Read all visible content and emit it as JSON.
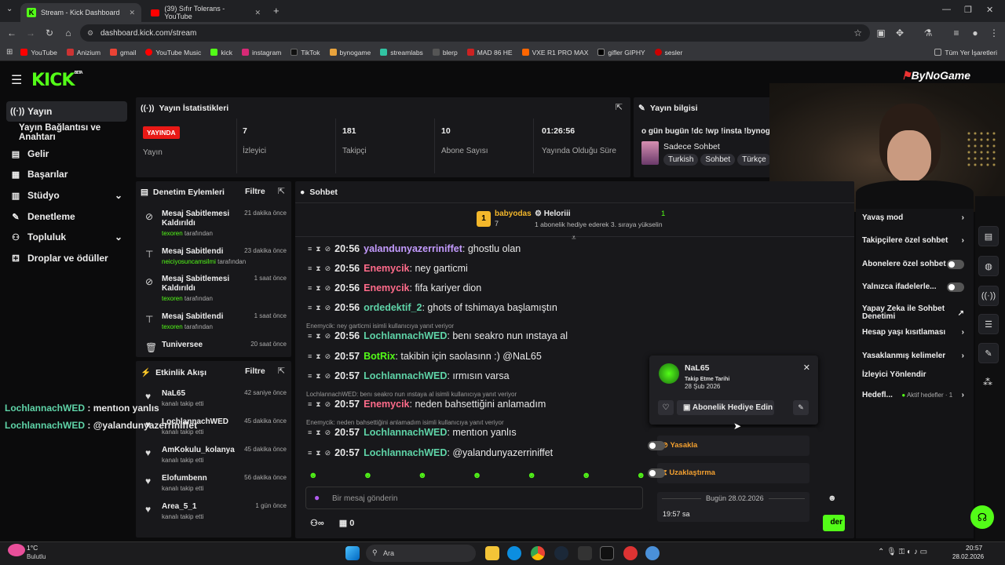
{
  "browser": {
    "tabs": [
      {
        "title": "Stream - Kick Dashboard"
      },
      {
        "title": "(39) Sıfır Tolerans - YouTube"
      }
    ],
    "url": "dashboard.kick.com/stream",
    "bookmarks": [
      "YouTube",
      "Anizium",
      "gmail",
      "YouTube Music",
      "kick",
      "instagram",
      "TikTok",
      "bynogame",
      "streamlabs",
      "blerp",
      "MAD 86 HE",
      "VXE R1 PRO MAX",
      "gifler GIPHY",
      "sesler"
    ],
    "all_bookmarks": "Tüm Yer İşaretleri"
  },
  "header": {
    "logo": "KICK",
    "beta": "BETA",
    "overlay_brand": "ByNoGame"
  },
  "sidebar": {
    "items": [
      {
        "label": "Yayın",
        "icon": "broadcast-icon"
      },
      {
        "label": "Yayın Bağlantısı ve Anahtarı"
      },
      {
        "label": "Gelir",
        "icon": "money-icon"
      },
      {
        "label": "Başarılar",
        "icon": "trophy-icon"
      },
      {
        "label": "Stüdyo",
        "icon": "studio-icon"
      },
      {
        "label": "Denetleme",
        "icon": "wrench-icon"
      },
      {
        "label": "Topluluk",
        "icon": "community-icon"
      },
      {
        "label": "Droplar ve ödüller",
        "icon": "gift-icon"
      }
    ]
  },
  "stats": {
    "title": "Yayın İstatistikleri",
    "live_badge": "YAYINDA",
    "live_label": "Yayın",
    "viewers": "7",
    "viewers_label": "İzleyici",
    "followers": "181",
    "followers_label": "Takipçi",
    "subs": "10",
    "subs_label": "Abone Sayısı",
    "uptime": "01:26:56",
    "uptime_label": "Yayında Olduğu Süre"
  },
  "info": {
    "title": "Yayın bilgisi",
    "stream_title": "o gün bugün !dc !wp !insta !bynogam",
    "category": "Sadece Sohbet",
    "tags": [
      "Turkish",
      "Sohbet",
      "Türkçe"
    ]
  },
  "mod": {
    "title": "Denetim Eylemleri",
    "filter": "Filtre",
    "items": [
      {
        "action": "Mesaj Sabitlemesi Kaldırıldı",
        "user": "texoren",
        "by": "tarafından",
        "time": "21 dakika önce"
      },
      {
        "action": "Mesaj Sabitlendi",
        "user": "neiciyosuncamsilmi",
        "by": "tarafından",
        "time": "23 dakika önce"
      },
      {
        "action": "Mesaj Sabitlemesi Kaldırıldı",
        "user": "texoren",
        "by": "tarafından",
        "time": "1 saat önce"
      },
      {
        "action": "Mesaj Sabitlendi",
        "user": "texoren",
        "by": "tarafından",
        "time": "1 saat önce"
      },
      {
        "action": "Tuniversee",
        "user": "",
        "by": "",
        "time": "20 saat önce"
      }
    ]
  },
  "activity": {
    "title": "Etkinlik Akışı",
    "filter": "Filtre",
    "items": [
      {
        "name": "NaL65",
        "desc": "kanalı takip etti",
        "time": "42 saniye önce"
      },
      {
        "name": "LochlannachWED",
        "desc": "kanalı takip etti",
        "time": "45 dakika önce"
      },
      {
        "name": "AmKokulu_kolanya",
        "desc": "kanalı takip etti",
        "time": "45 dakika önce"
      },
      {
        "name": "Elofumbenn",
        "desc": "kanalı takip etti",
        "time": "56 dakika önce"
      },
      {
        "name": "Area_5_1",
        "desc": "kanalı takip etti",
        "time": "1 gün önce"
      }
    ]
  },
  "chat": {
    "title": "Sohbet",
    "gift_user": "babyodas",
    "gift_count": "7",
    "gift_user2": "Heloriii",
    "gift_count2": "1",
    "gift_text": "1 abonelik hediye ederek 3. sıraya yükselin",
    "messages": [
      {
        "time": "20:56",
        "user": "yalandunyazerriniffet",
        "text": "ghostlu olan",
        "color": "#c49bff"
      },
      {
        "time": "20:56",
        "user": "Enemycik",
        "text": "ney garticmi",
        "color": "#ff6b8a"
      },
      {
        "time": "20:56",
        "user": "Enemycik",
        "text": "fifa kariyer dion",
        "color": "#ff6b8a"
      },
      {
        "time": "20:56",
        "user": "ordedektif_2",
        "text": "ghots of tshimaya başlamıştın",
        "color": "#5fd4a8"
      },
      {
        "time": "20:56",
        "user": "LochlannachWED",
        "text": "benı seakro nun ınstaya al",
        "color": "#5fd4a8",
        "reply": "Enemycik: ney garticmi isimli kullanıcıya yanıt veriyor"
      },
      {
        "time": "20:57",
        "user": "BotRix",
        "text": "takibin için saolasınn :) @NaL65",
        "color": "#53fc18"
      },
      {
        "time": "20:57",
        "user": "LochlannachWED",
        "text": "ırmısın varsa",
        "color": "#5fd4a8"
      },
      {
        "time": "20:57",
        "user": "Enemycik",
        "text": "neden bahsettiğini anlamadım",
        "color": "#ff6b8a",
        "reply": "LochlannachWED: benı seakro nun ınstaya al isimli kullanıcıya yanıt veriyor"
      },
      {
        "time": "20:57",
        "user": "LochlannachWED",
        "text": "mentıon yanlıs",
        "color": "#5fd4a8",
        "reply": "Enemycik: neden bahsettiğini anlamadım isimli kullanıcıya yanıt veriyor"
      },
      {
        "time": "20:57",
        "user": "LochlannachWED",
        "text": "@yalandunyazerriniffet",
        "color": "#5fd4a8"
      }
    ],
    "placeholder": "Bir mesaj gönderin",
    "points": "0",
    "send": "der"
  },
  "overlay_chat": [
    {
      "user": "LochlannachWED",
      "text": "mentıon yanlıs"
    },
    {
      "user": "LochlannachWED",
      "text": "@yalandunyazerriniffet"
    }
  ],
  "usercard": {
    "name": "NaL65",
    "follow_label": "Takip Etme Tarihi",
    "follow_date": "28 Şub 2026",
    "gift_btn": "Abonelik Hediye Edin",
    "ban": "Yasakla",
    "timeout": "Uzaklaştırma",
    "date_sep": "Bugün 28.02.2026",
    "time": "19:57 sa"
  },
  "chatsettings": {
    "items": [
      "Yavaş mod",
      "Takipçilere özel sohbet",
      "Abonelere özel sohbet",
      "Yalnızca ifadelerle...",
      "Yapay Zeka ile Sohbet Denetimi",
      "Hesap yaşı kısıtlaması",
      "Yasaklanmış kelimeler",
      "İzleyici Yönlendir",
      "Hedefl..."
    ],
    "goal_note": "Aktif hedefler · 1"
  },
  "taskbar": {
    "temp": "1°C",
    "weather": "Bulutlu",
    "search": "Ara",
    "clock": "20:57",
    "date": "28.02.2026"
  }
}
